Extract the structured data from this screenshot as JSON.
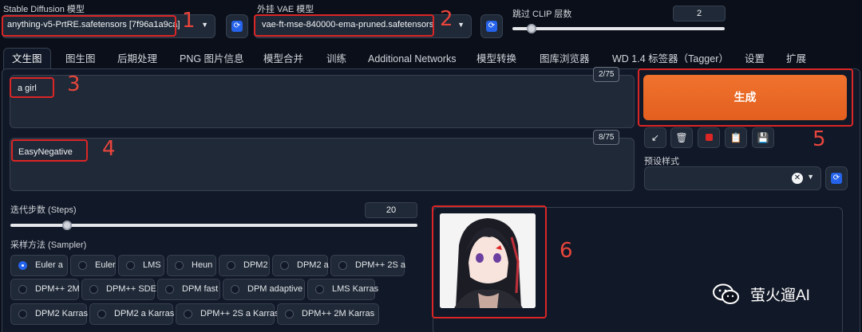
{
  "header": {
    "model_label": "Stable Diffusion 模型",
    "model_value": "anything-v5-PrtRE.safetensors [7f96a1a9ca]",
    "vae_label": "外挂 VAE 模型",
    "vae_value": "vae-ft-mse-840000-ema-pruned.safetensors",
    "clip_label": "跳过 CLIP 层数",
    "clip_value": "2"
  },
  "tabs": [
    {
      "label": "文生图",
      "active": true
    },
    {
      "label": "图生图"
    },
    {
      "label": "后期处理"
    },
    {
      "label": "PNG 图片信息"
    },
    {
      "label": "模型合并"
    },
    {
      "label": "训练"
    },
    {
      "label": "Additional Networks"
    },
    {
      "label": "模型转换"
    },
    {
      "label": "图库浏览器"
    },
    {
      "label": "WD 1.4 标签器（Tagger）"
    },
    {
      "label": "设置"
    },
    {
      "label": "扩展"
    }
  ],
  "prompt": {
    "value": "a girl",
    "counter": "2/75"
  },
  "negative_prompt": {
    "value": "EasyNegative",
    "counter": "8/75"
  },
  "generate_label": "生成",
  "styles_label": "预设样式",
  "tool_icons": [
    "arrow-icon",
    "trash-icon",
    "card-icon",
    "clipboard-icon",
    "save-icon"
  ],
  "steps": {
    "label": "迭代步数 (Steps)",
    "value": "20",
    "fraction": 0.14
  },
  "sampler": {
    "label": "采样方法 (Sampler)",
    "options": [
      "Euler a",
      "Euler",
      "LMS",
      "Heun",
      "DPM2",
      "DPM2 a",
      "DPM++ 2S a",
      "DPM++ 2M",
      "DPM++ SDE",
      "DPM fast",
      "DPM adaptive",
      "LMS Karras",
      "DPM2 Karras",
      "DPM2 a Karras",
      "DPM++ 2S a Karras",
      "DPM++ 2M Karras"
    ],
    "selected": "Euler a"
  },
  "annotations": [
    "1",
    "2",
    "3",
    "4",
    "5",
    "6"
  ],
  "watermark": "萤火遛AI",
  "colors": {
    "accent": "#e8682a",
    "highlight": "#dc2626",
    "background": "#0b0f19"
  }
}
